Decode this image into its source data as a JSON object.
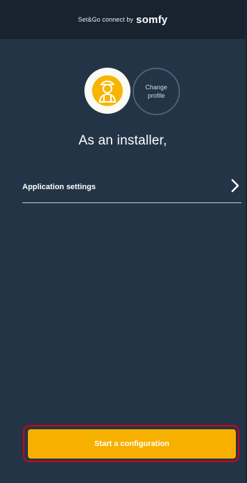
{
  "header": {
    "brand_prefix": "Set&Go connect by",
    "brand_name": "somfy"
  },
  "profile": {
    "avatar_icon": "installer-icon",
    "change_profile_line1": "Change",
    "change_profile_line2": "profile"
  },
  "main": {
    "headline": "As an installer,",
    "settings_label": "Application settings",
    "settings_icon": "chevron-right-icon"
  },
  "footer": {
    "start_label": "Start a configuration"
  },
  "colors": {
    "background": "#243447",
    "topbar": "#182330",
    "accent": "#f8b000",
    "highlight": "#d7000f"
  }
}
